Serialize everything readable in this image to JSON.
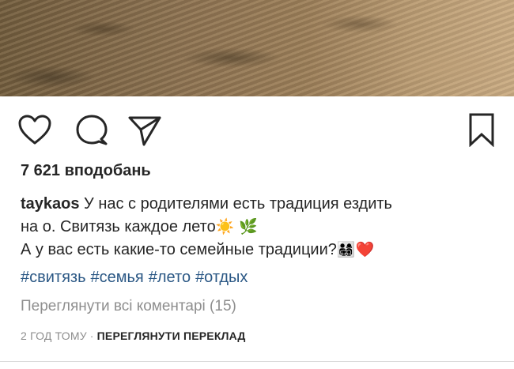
{
  "post": {
    "likes_text": "7 621 вподобань",
    "caption": {
      "username": "taykaos",
      "line1_text": " У нас с родителями есть традиция ездить",
      "line2_text": "на о. Свитязь каждое лето",
      "line2_emoji_1": "☀️",
      "line2_emoji_2": "🌿",
      "line3_text": "А у вас есть какие-то семейные традиции?",
      "line3_emoji_1": "👨‍👩‍👧‍👦",
      "line3_emoji_2": "❤️"
    },
    "hashtags": [
      "#свитязь",
      "#семья",
      "#лето",
      "#отдых"
    ],
    "view_comments_text": "Переглянути всі коментарі (15)",
    "time_ago": "2 ГОД ТОМУ",
    "separator": "·",
    "translate_label": "ПЕРЕГЛЯНУТИ ПЕРЕКЛАД"
  },
  "icons": {
    "like": "heart-icon",
    "comment": "comment-bubble-icon",
    "share": "paper-plane-icon",
    "save": "bookmark-icon"
  },
  "colors": {
    "text": "#262626",
    "secondary": "#8e8e8e",
    "hashtag": "#2b5885"
  }
}
